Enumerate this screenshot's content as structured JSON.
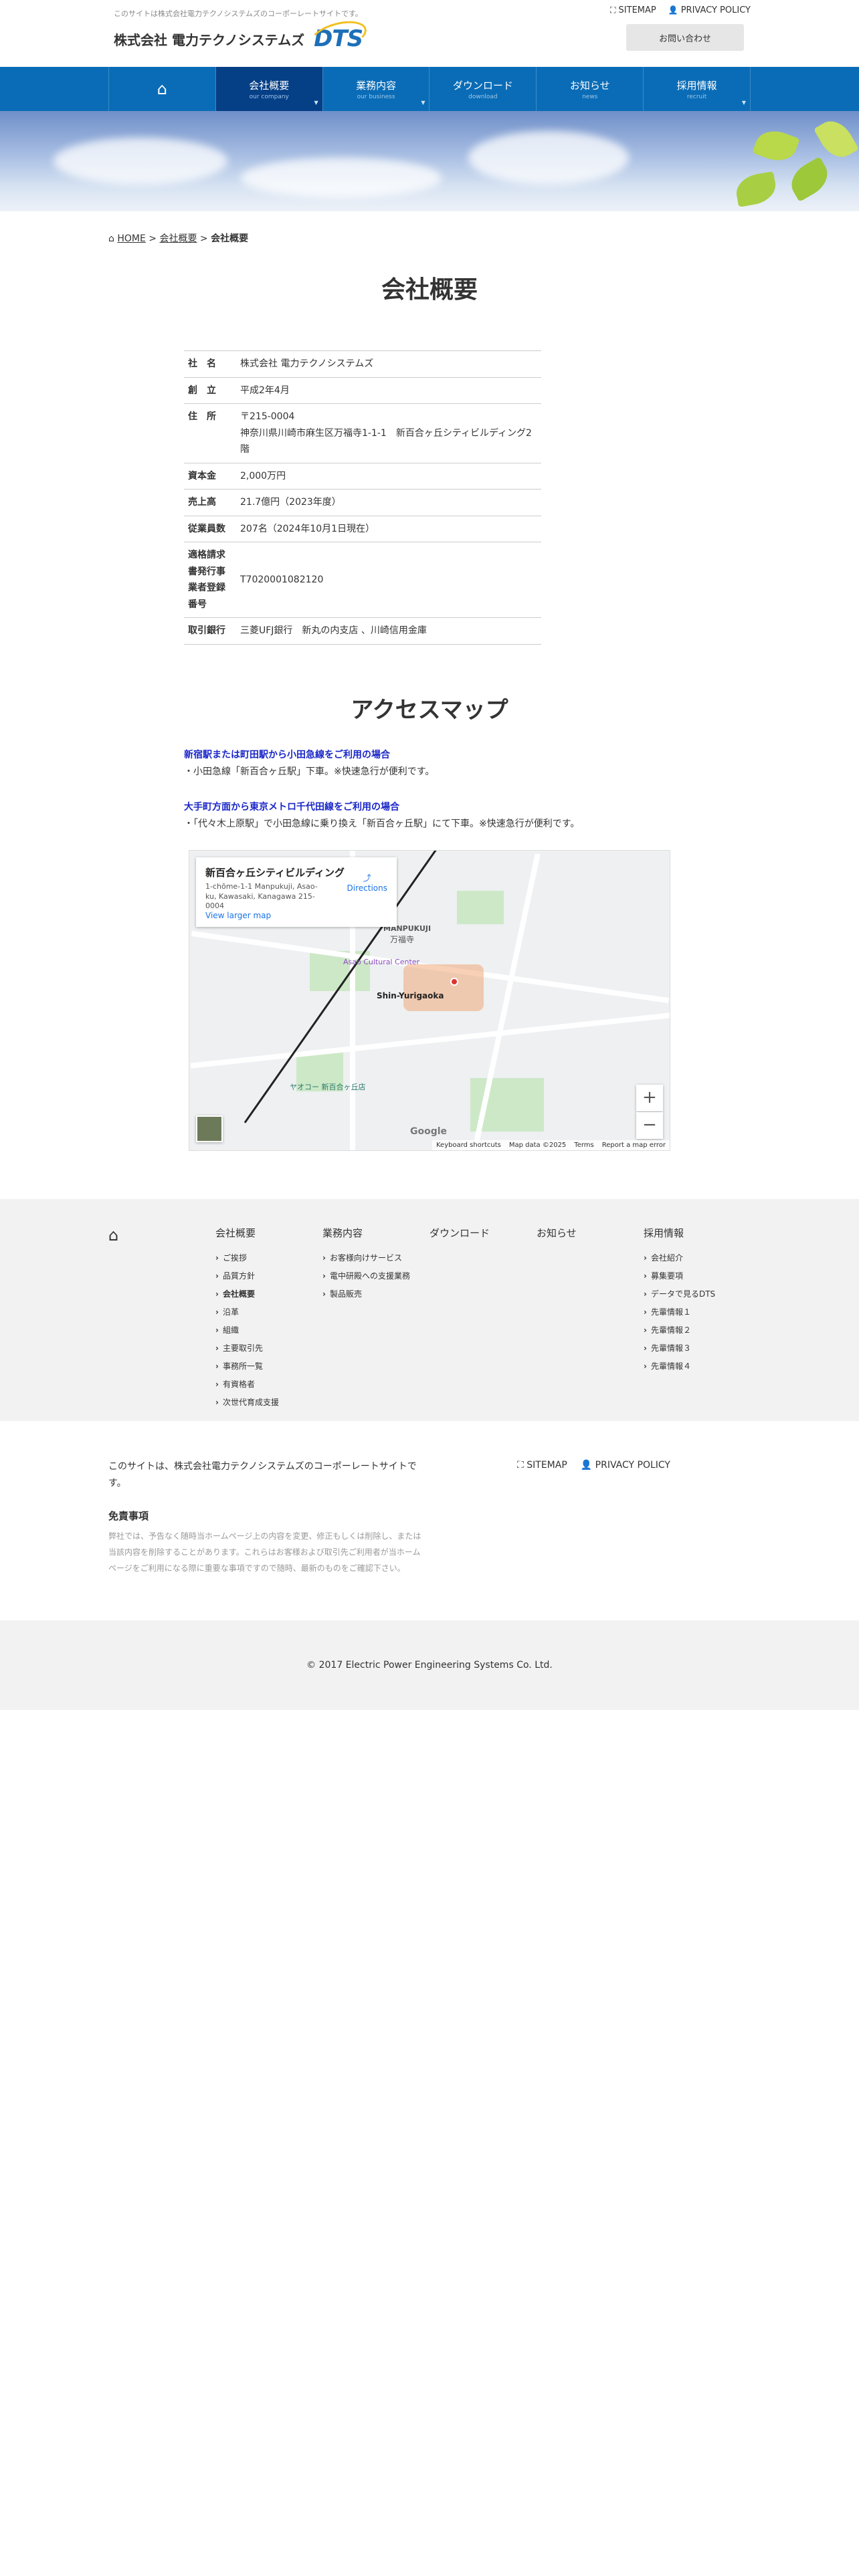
{
  "header": {
    "tagline": "このサイトは株式会社電力テクノシステムズのコーポーレートサイトです。",
    "company_name": "株式会社 電力テクノシステムズ",
    "logo_mark": "DTS",
    "sitemap": "SITEMAP",
    "privacy": "PRIVACY POLICY",
    "contact": "お問い合わせ"
  },
  "nav": [
    {
      "jp": "会社概要",
      "en": "our company"
    },
    {
      "jp": "業務内容",
      "en": "our business"
    },
    {
      "jp": "ダウンロード",
      "en": "download"
    },
    {
      "jp": "お知らせ",
      "en": "news"
    },
    {
      "jp": "採用情報",
      "en": "recruit"
    }
  ],
  "breadcrumb": {
    "home": "HOME",
    "sep": ">",
    "parent": "会社概要",
    "current": "会社概要"
  },
  "page_title": "会社概要",
  "company_table": [
    {
      "k": "社　名",
      "v": "株式会社 電力テクノシステムズ"
    },
    {
      "k": "創　立",
      "v": "平成2年4月"
    },
    {
      "k": "住　所",
      "v": "〒215-0004",
      "v2": "神奈川県川崎市麻生区万福寺1-1-1　新百合ヶ丘シティビルディング2階"
    },
    {
      "k": "資本金",
      "v": "2,000万円"
    },
    {
      "k": "売上高",
      "v": "21.7億円（2023年度）"
    },
    {
      "k": "従業員数",
      "v": "207名（2024年10月1日現在）"
    },
    {
      "k": "適格請求書発行事業者登録番号",
      "v": "T7020001082120"
    },
    {
      "k": "取引銀行",
      "v": "三菱UFJ銀行　新丸の内支店 、川崎信用金庫"
    }
  ],
  "access": {
    "title": "アクセスマップ",
    "route1_h": "新宿駅または町田駅から小田急線をご利用の場合",
    "route1_t": "・小田急線「新百合ヶ丘駅」下車。※快速急行が便利です。",
    "route2_h": "大手町方面から東京メトロ千代田線をご利用の場合",
    "route2_t": "・「代々木上原駅」で小田急線に乗り換え「新百合ヶ丘駅」にて下車。※快速急行が便利です。"
  },
  "map": {
    "place": "新百合ヶ丘シティビルディング",
    "address": "1-chōme-1-1 Manpukuji, Asao-ku, Kawasaki, Kanagawa 215-0004",
    "directions": "Directions",
    "larger": "View larger map",
    "station": "Shin-Yurigaoka",
    "area": "MANPUKUJI",
    "area_jp": "万福寺",
    "cultural": "Asao Cultural Center",
    "yaohan": "ヤオコー 新百合ヶ丘店",
    "shortcuts": "Keyboard shortcuts",
    "mapdata": "Map data ©2025",
    "terms": "Terms",
    "report": "Report a map error",
    "google": "Google"
  },
  "footer_nav": [
    {
      "hd": "会社概要",
      "items": [
        "ご挨拶",
        "品質方針",
        "会社概要",
        "沿革",
        "組織",
        "主要取引先",
        "事務所一覧",
        "有資格者",
        "次世代育成支援"
      ],
      "current": 2
    },
    {
      "hd": "業務内容",
      "items": [
        "お客様向けサービス",
        "電中研殿への支援業務",
        "製品販売"
      ]
    },
    {
      "hd": "ダウンロード",
      "items": []
    },
    {
      "hd": "お知らせ",
      "items": []
    },
    {
      "hd": "採用情報",
      "items": [
        "会社紹介",
        "募集要項",
        "データで見るDTS",
        "先輩情報１",
        "先輩情報２",
        "先輩情報３",
        "先輩情報４"
      ]
    }
  ],
  "site_info": {
    "desc": "このサイトは、株式会社電力テクノシステムズのコーポーレートサイトです。",
    "disclaimer_h": "免責事項",
    "disclaimer": "弊社では、予告なく随時当ホームページ上の内容を変更、修正もしくは削除し、または当該内容を削除することがあります。これらはお客様および取引先ご利用者が当ホームページをご利用になる際に重要な事項ですので随時、最新のものをご確認下さい。"
  },
  "copyright": "© 2017 Electric Power Engineering Systems Co. Ltd."
}
